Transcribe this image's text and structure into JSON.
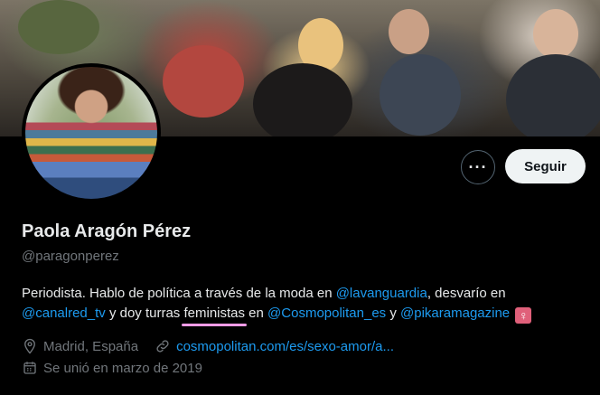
{
  "profile": {
    "name": "Paola Aragón Pérez",
    "handle": "@paragonperez",
    "bio": {
      "t1": "Periodista. Hablo de política a través de la moda en ",
      "m1": "@lavanguardia",
      "t2": ", desvarío en",
      "m2": "@canalred_tv",
      "t3": " y doy turras ",
      "highlight": "feministas",
      "t4": " en ",
      "m3": "@Cosmopolitan_es",
      "t5": " y ",
      "m4": "@pikaramagazine",
      "emoji": "♀"
    },
    "location": "Madrid, España",
    "website": "cosmopolitan.com/es/sexo-amor/a...",
    "joined": "Se unió en marzo de 2019"
  },
  "actions": {
    "more_label": "···",
    "follow_label": "Seguir"
  },
  "icons": {
    "location": "map-pin-icon",
    "website": "link-icon",
    "joined": "calendar-icon"
  },
  "colors": {
    "background": "#000000",
    "link": "#1d9bf0",
    "muted": "#71767b",
    "highlight_underline": "#f09be6"
  }
}
